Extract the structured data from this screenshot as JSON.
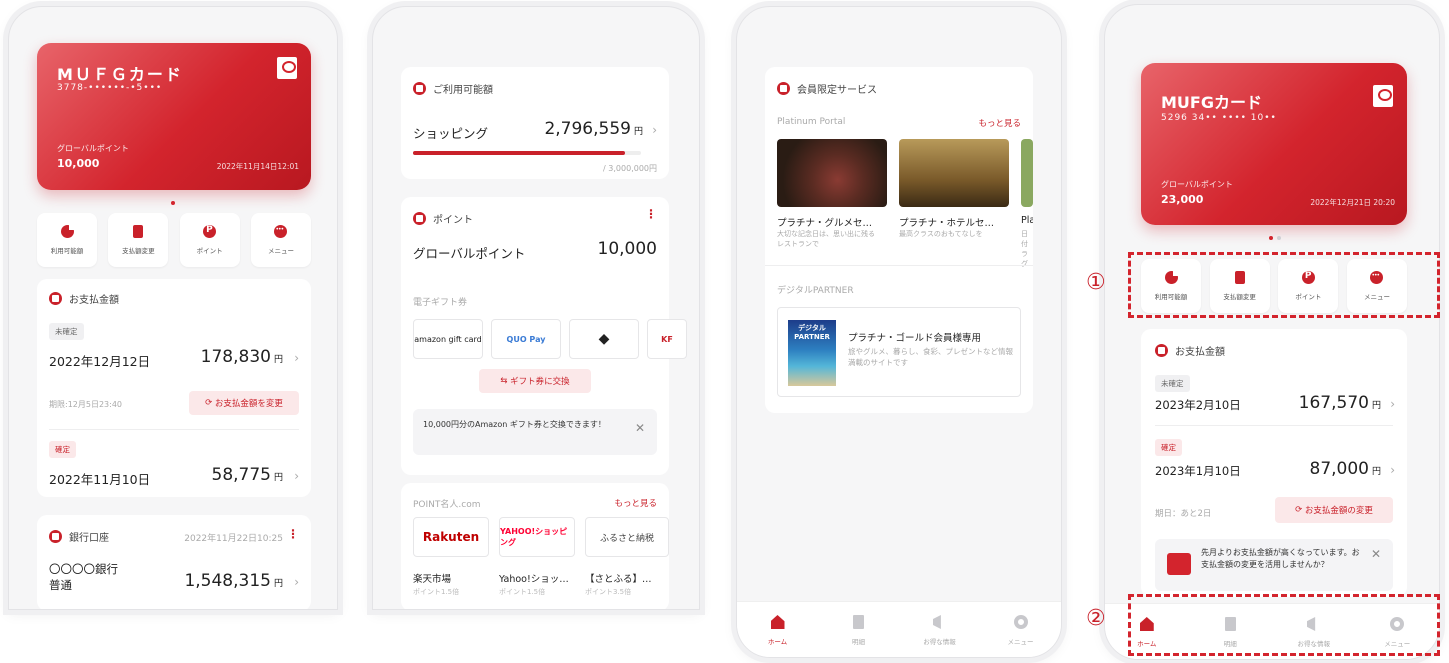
{
  "colors": {
    "accent": "#d3242d",
    "accent_soft": "#fbe8e9",
    "annotation": "#d3242d"
  },
  "screen1": {
    "card": {
      "name": "MＵＦＧカード",
      "number": "3778-••••••-•5•••",
      "points_label": "グローバルポイント",
      "points": "10,000",
      "updated": "2022年11月14日12:01"
    },
    "quick": [
      {
        "label": "利用可能額",
        "icon": "pie-chart-icon"
      },
      {
        "label": "支払額変更",
        "icon": "document-yen-icon"
      },
      {
        "label": "ポイント",
        "icon": "point-icon"
      },
      {
        "label": "メニュー",
        "icon": "more-icon"
      }
    ],
    "payment": {
      "title": "お支払金額",
      "pending_tag": "未確定",
      "pending_date": "2022年12月12日",
      "pending_amount": "178,830",
      "deadline": "期限:12月5日23:40",
      "change_button": "お支払金額を変更",
      "fixed_tag": "確定",
      "fixed_date": "2022年11月10日",
      "fixed_amount": "58,775",
      "yen": "円"
    },
    "bank": {
      "title": "銀行口座",
      "updated": "2022年11月22日10:25",
      "name": "〇〇〇〇銀行",
      "type": "普通",
      "amount": "1,548,315",
      "yen": "円"
    }
  },
  "screen2": {
    "available": {
      "title": "ご利用可能額",
      "label": "ショッピング",
      "amount": "2,796,559",
      "yen": "円",
      "limit": "/ 3,000,000円",
      "usage_fraction": 0.93
    },
    "points": {
      "title": "ポイント",
      "label": "グローバルポイント",
      "value": "10,000",
      "gift_title": "電子ギフト券",
      "gifts": [
        "amazon gift card",
        "QUO Pay",
        "",
        "KF"
      ],
      "exchange_button": "ギフト券に交換",
      "notice": "10,000円分のAmazon ギフト券と交換できます！"
    },
    "point_site": {
      "title": "POINT名人.com",
      "more": "もっと見る",
      "stores": [
        {
          "logo": "Rakuten",
          "name": "楽天市場",
          "rate": "ポイント1.5倍"
        },
        {
          "logo": "YAHOO!ショッピング",
          "name": "Yahoo!ショッ…",
          "rate": "ポイント1.5倍"
        },
        {
          "logo": "ふるさと納税",
          "name": "【さとふる】…",
          "rate": "ポイント3.5倍"
        }
      ]
    }
  },
  "screen3": {
    "members": {
      "title": "会員限定サービス",
      "sub": "Platinum Portal",
      "more": "もっと見る",
      "items": [
        {
          "name": "プラチナ・グルメセ…",
          "desc": "大切な記念日は、思い出に残るレストランで"
        },
        {
          "name": "プラチナ・ホテルセ…",
          "desc": "最高クラスのおもてなしを"
        },
        {
          "name": "Pla",
          "desc": "日付ラグ"
        }
      ],
      "partner_title": "デジタルPARTNER",
      "partner_logo": "デジタル PARTNER",
      "partner_name": "プラチナ・ゴールド会員様専用",
      "partner_desc": "旅やグルメ、暮らし、食彩、プレゼントなど情報満載のサイトです"
    },
    "tabs": [
      "ホーム",
      "明細",
      "お得な情報",
      "メニュー"
    ]
  },
  "screen4": {
    "card": {
      "name": "MUFGカード",
      "number": "5296 34•• •••• 10••",
      "points_label": "グローバルポイント",
      "points": "23,000",
      "updated": "2022年12月21日 20:20"
    },
    "quick": [
      {
        "label": "利用可能額",
        "icon": "pie-chart-icon"
      },
      {
        "label": "支払額変更",
        "icon": "document-yen-icon"
      },
      {
        "label": "ポイント",
        "icon": "point-icon"
      },
      {
        "label": "メニュー",
        "icon": "more-icon"
      }
    ],
    "payment": {
      "title": "お支払金額",
      "pending_tag": "未確定",
      "pending_date": "2023年2月10日",
      "pending_amount": "167,570",
      "fixed_tag": "確定",
      "fixed_date": "2023年1月10日",
      "fixed_amount": "87,000",
      "yen": "円",
      "deadline": "期日：あと2日",
      "change_button": "お支払金額の変更",
      "notice": "先月よりお支払金額が高くなっています。お支払金額の変更を活用しませんか？"
    },
    "tabs": [
      "ホーム",
      "明細",
      "お得な情報",
      "メニュー"
    ],
    "callouts": [
      "①",
      "②"
    ]
  }
}
